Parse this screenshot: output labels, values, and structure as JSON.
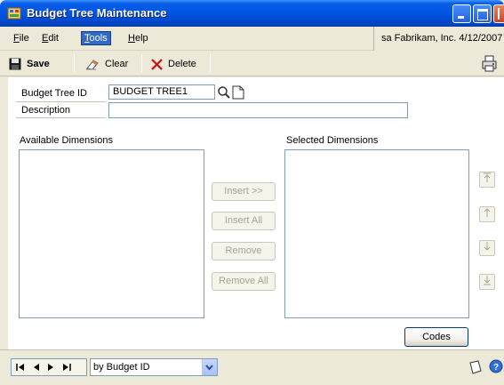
{
  "window": {
    "title": "Budget Tree Maintenance",
    "status_text": "sa  Fabrikam, Inc.  4/12/2007"
  },
  "menu": {
    "items": [
      {
        "label": "File",
        "accel": "F",
        "rest": "ile"
      },
      {
        "label": "Edit",
        "accel": "E",
        "rest": "dit"
      },
      {
        "label": "Tools",
        "accel": "T",
        "rest": "ools"
      },
      {
        "label": "Help",
        "accel": "H",
        "rest": "elp"
      }
    ]
  },
  "toolbar": {
    "save_label": "Save",
    "clear_label": "Clear",
    "delete_label": "Delete"
  },
  "form": {
    "tree_id_label": "Budget Tree ID",
    "tree_id_value": "BUDGET TREE1",
    "description_label": "Description",
    "description_value": "",
    "available_label": "Available Dimensions",
    "selected_label": "Selected Dimensions",
    "available_items": [],
    "selected_items": []
  },
  "buttons": {
    "insert": "Insert >>",
    "insert_all": "Insert All",
    "remove": "Remove",
    "remove_all": "Remove All",
    "codes": "Codes"
  },
  "navigation": {
    "sort_value": "by Budget ID"
  },
  "colors": {
    "titlebar": "#0054e3",
    "window_bg": "#ece9d8",
    "menu_highlight": "#316ac5",
    "field_border": "#7f9db9"
  }
}
